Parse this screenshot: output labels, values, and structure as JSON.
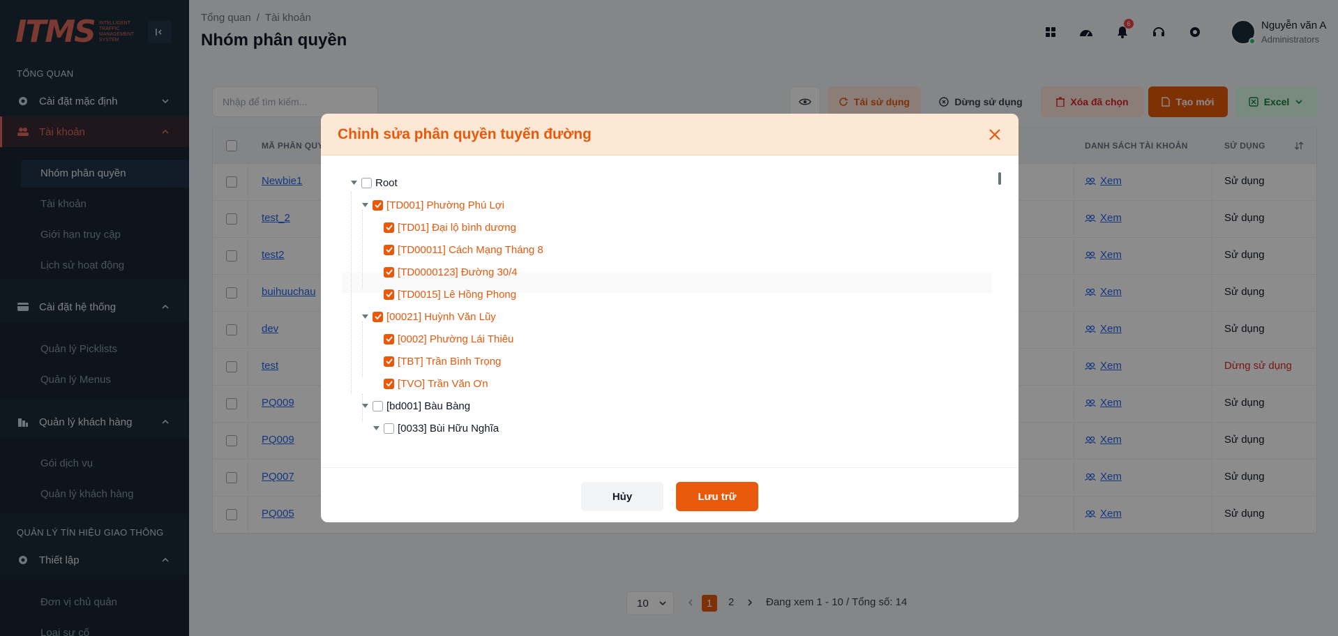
{
  "sidebar": {
    "logo_text": "ITMS",
    "logo_sub": "INTELLIGENT TRAFFIC MANAGEMENT SYSTEM",
    "section_overview": "TỔNG QUAN",
    "section_traffic": "QUẢN LÝ TÍN HIỆU GIAO THÔNG",
    "groups": [
      {
        "label": "Cài đặt mặc định",
        "icon": "gear-icon"
      },
      {
        "label": "Tài khoản",
        "icon": "users-icon"
      },
      {
        "label": "Cài đặt hệ thống",
        "icon": "card-icon"
      },
      {
        "label": "Quản lý khách hàng",
        "icon": "building-icon"
      },
      {
        "label": "Thiết lập",
        "icon": "gear-icon"
      }
    ],
    "account_items": [
      "Nhóm phân quyền",
      "Tài khoản",
      "Giới hạn truy cập",
      "Lịch sử hoạt động"
    ],
    "system_items": [
      "Quản lý Picklists",
      "Quản lý Menus"
    ],
    "customer_items": [
      "Gói dịch vụ",
      "Quản lý khách hàng"
    ],
    "setup_items": [
      "Đơn vị chủ quản",
      "Loại sự cố"
    ]
  },
  "header": {
    "breadcrumb": [
      "Tổng quan",
      "Tài khoản"
    ],
    "breadcrumb_sep": "/",
    "title": "Nhóm phân quyền",
    "notification_count": "6",
    "user_name": "Nguyễn văn A",
    "user_role": "Administrators"
  },
  "toolbar": {
    "search_placeholder": "Nhập để tìm kiếm...",
    "reuse_label": "Tái sử dụng",
    "stop_label": "Dừng sử dụng",
    "delete_label": "Xóa đã chọn",
    "create_label": "Tạo mới",
    "excel_label": "Excel",
    "accent": "#e8590c"
  },
  "table": {
    "headers": {
      "code": "MÃ PHÂN QUYỀN",
      "accounts": "DANH SÁCH TÀI KHOẢN",
      "usage": "SỬ DỤNG"
    },
    "view_label": "Xem",
    "rows": [
      {
        "code": "Newbie1",
        "status": "Sử dụng"
      },
      {
        "code": "test_2",
        "status": "Sử dụng"
      },
      {
        "code": "test2",
        "status": "Sử dụng"
      },
      {
        "code": "buihuuchau",
        "status": "Sử dụng"
      },
      {
        "code": "dev",
        "status": "Sử dụng"
      },
      {
        "code": "test",
        "status": "Dừng sử dụng"
      },
      {
        "code": "PQ009",
        "status": "Sử dụng"
      },
      {
        "code": "PQ009",
        "status": "Sử dụng"
      },
      {
        "code": "PQ007",
        "status": "Sử dụng"
      },
      {
        "code": "PQ005",
        "status": "Sử dụng"
      }
    ]
  },
  "pagination": {
    "page_size": "10",
    "pages": [
      "1",
      "2"
    ],
    "current": "1",
    "info": "Đang xem 1 - 10 / Tổng số: 14"
  },
  "modal": {
    "title": "Chỉnh sửa phân quyền tuyến đường",
    "cancel_label": "Hủy",
    "save_label": "Lưu trữ",
    "tree": [
      {
        "label": "Root",
        "level": 0,
        "checked": false,
        "caret": true
      },
      {
        "label": "[TD001] Phường Phú Lợi",
        "level": 1,
        "checked": true,
        "caret": true
      },
      {
        "label": "[TD01] Đại lộ bình dương",
        "level": 2,
        "checked": true,
        "caret": false
      },
      {
        "label": "[TD00011] Cách Mạng Tháng 8",
        "level": 2,
        "checked": true,
        "caret": false
      },
      {
        "label": "[TD0000123] Đường 30/4",
        "level": 2,
        "checked": true,
        "caret": false
      },
      {
        "label": "[TD0015] Lê Hồng Phong",
        "level": 2,
        "checked": true,
        "caret": false
      },
      {
        "label": "[00021] Huỳnh Văn Lũy",
        "level": 1,
        "checked": true,
        "caret": true
      },
      {
        "label": "[0002] Phường Lái Thiêu",
        "level": 2,
        "checked": true,
        "caret": false
      },
      {
        "label": "[TBT] Trần Bình Trọng",
        "level": 2,
        "checked": true,
        "caret": false
      },
      {
        "label": "[TVO] Trần Văn Ơn",
        "level": 2,
        "checked": true,
        "caret": false
      },
      {
        "label": "[bd001] Bàu Bàng",
        "level": 1,
        "checked": false,
        "caret": true
      },
      {
        "label": "[0033] Bùi Hữu Nghĩa",
        "level": 2,
        "checked": false,
        "caret": true
      }
    ]
  }
}
